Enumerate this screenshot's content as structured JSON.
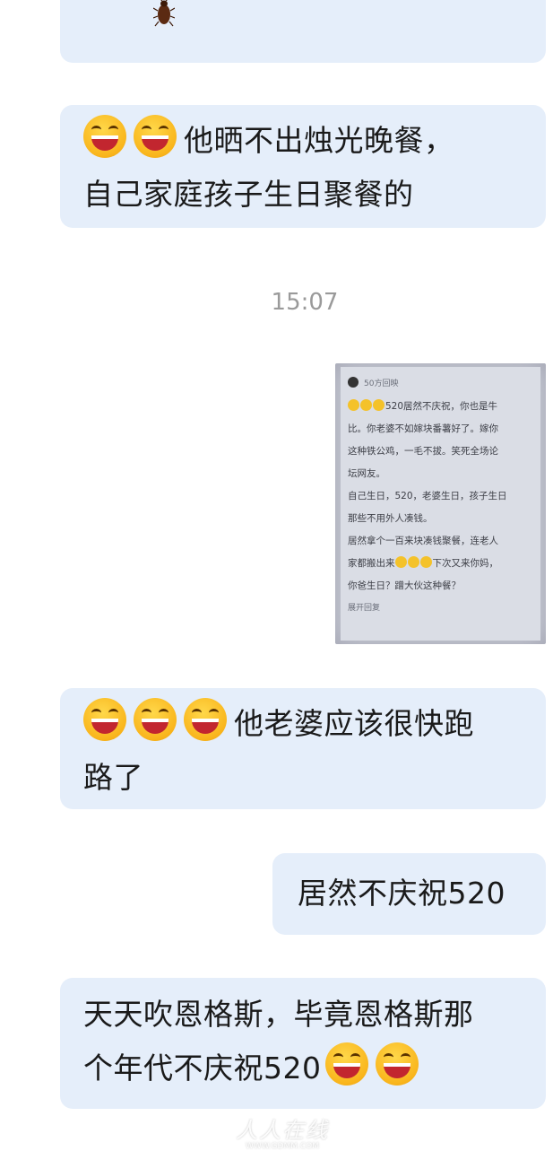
{
  "messages": {
    "m1": {
      "emoji": "cockroach-emoji"
    },
    "m2": {
      "line1": "他晒不出烛光晚餐，",
      "line2": "自己家庭孩子生日聚餐的"
    },
    "time": "15:07",
    "photo": {
      "header": "50方回映",
      "p1a": "520居然不庆祝，你也是牛",
      "p1b": "比。你老婆不如嫁块番薯好了。嫁你",
      "p1c": "这种铁公鸡，一毛不拔。笑死全场论",
      "p1d": "坛网友。",
      "p2a": "自己生日，520，老婆生日，孩子生日",
      "p2b": "那些不用外人凑钱。",
      "p3a": "居然拿个一百来块凑钱聚餐，连老人",
      "p3b": "家都搬出来",
      "p3c": "下次又来你妈，",
      "p3d": "你爸生日？蹭大伙这种餐？",
      "footer": "展开回复"
    },
    "m3": {
      "line1": "他老婆应该很快跑",
      "line2": "路了"
    },
    "m4": {
      "text": "居然不庆祝520"
    },
    "m5": {
      "line1": "天天吹恩格斯，毕竟恩格斯那",
      "line2": "个年代不庆祝520"
    }
  },
  "watermark": {
    "main": "人人在线",
    "url": "WWW.GDMM.COM"
  }
}
